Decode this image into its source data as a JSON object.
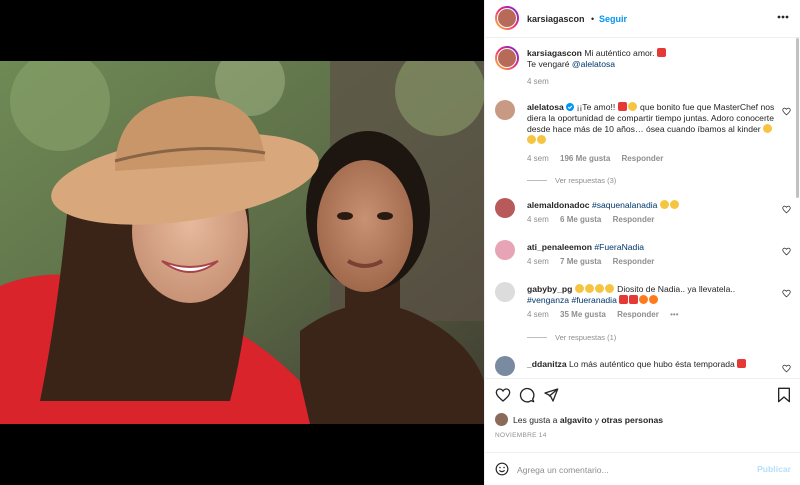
{
  "post": {
    "author": "karsiagascon",
    "follow_label": "Seguir",
    "dot": "•",
    "caption_line1": "Mi auténtico amor.",
    "caption_line2": "Te vengaré",
    "caption_mention": "@alelatosa",
    "caption_time": "4 sem"
  },
  "comments": [
    {
      "user": "alelatosa",
      "verified": true,
      "text_a": "¡¡Te amo!!",
      "text_b": "que bonito fue que MasterChef nos diera la oportunidad de compartir tiempo juntas. Adoro conocerte desde hace más de 10 años… ósea cuando íbamos al kinder",
      "time": "4 sem",
      "likes": "196 Me gusta",
      "reply": "Responder",
      "view_replies": "Ver respuestas (3)"
    },
    {
      "user": "alemaldonadoc",
      "tag": "#saquenalanadia",
      "time": "4 sem",
      "likes": "6 Me gusta",
      "reply": "Responder"
    },
    {
      "user": "ati_penaleemon",
      "tag": "#FueraNadia",
      "time": "4 sem",
      "likes": "7 Me gusta",
      "reply": "Responder"
    },
    {
      "user": "gabyby_pg",
      "text_a": "Diosito de Nadia.. ya llevatela..",
      "tag_a": "#venganza",
      "tag_b": "#fueranadia",
      "time": "4 sem",
      "likes": "35 Me gusta",
      "reply": "Responder",
      "more": "•••",
      "view_replies": "Ver respuestas (1)"
    },
    {
      "user": "_ddanitza",
      "text_a": "Lo más auténtico que hubo ésta temporada"
    }
  ],
  "likes_line": {
    "prefix": "Les gusta a",
    "user": "algavito",
    "joiner": "y",
    "others": "otras personas"
  },
  "date": "NOVIEMBRE 14",
  "add_comment": {
    "placeholder": "Agrega un comentario...",
    "publish": "Publicar"
  },
  "colors": {
    "accent": "#0095f6",
    "heart": "#ed4956",
    "muted": "#8e8e8e"
  }
}
